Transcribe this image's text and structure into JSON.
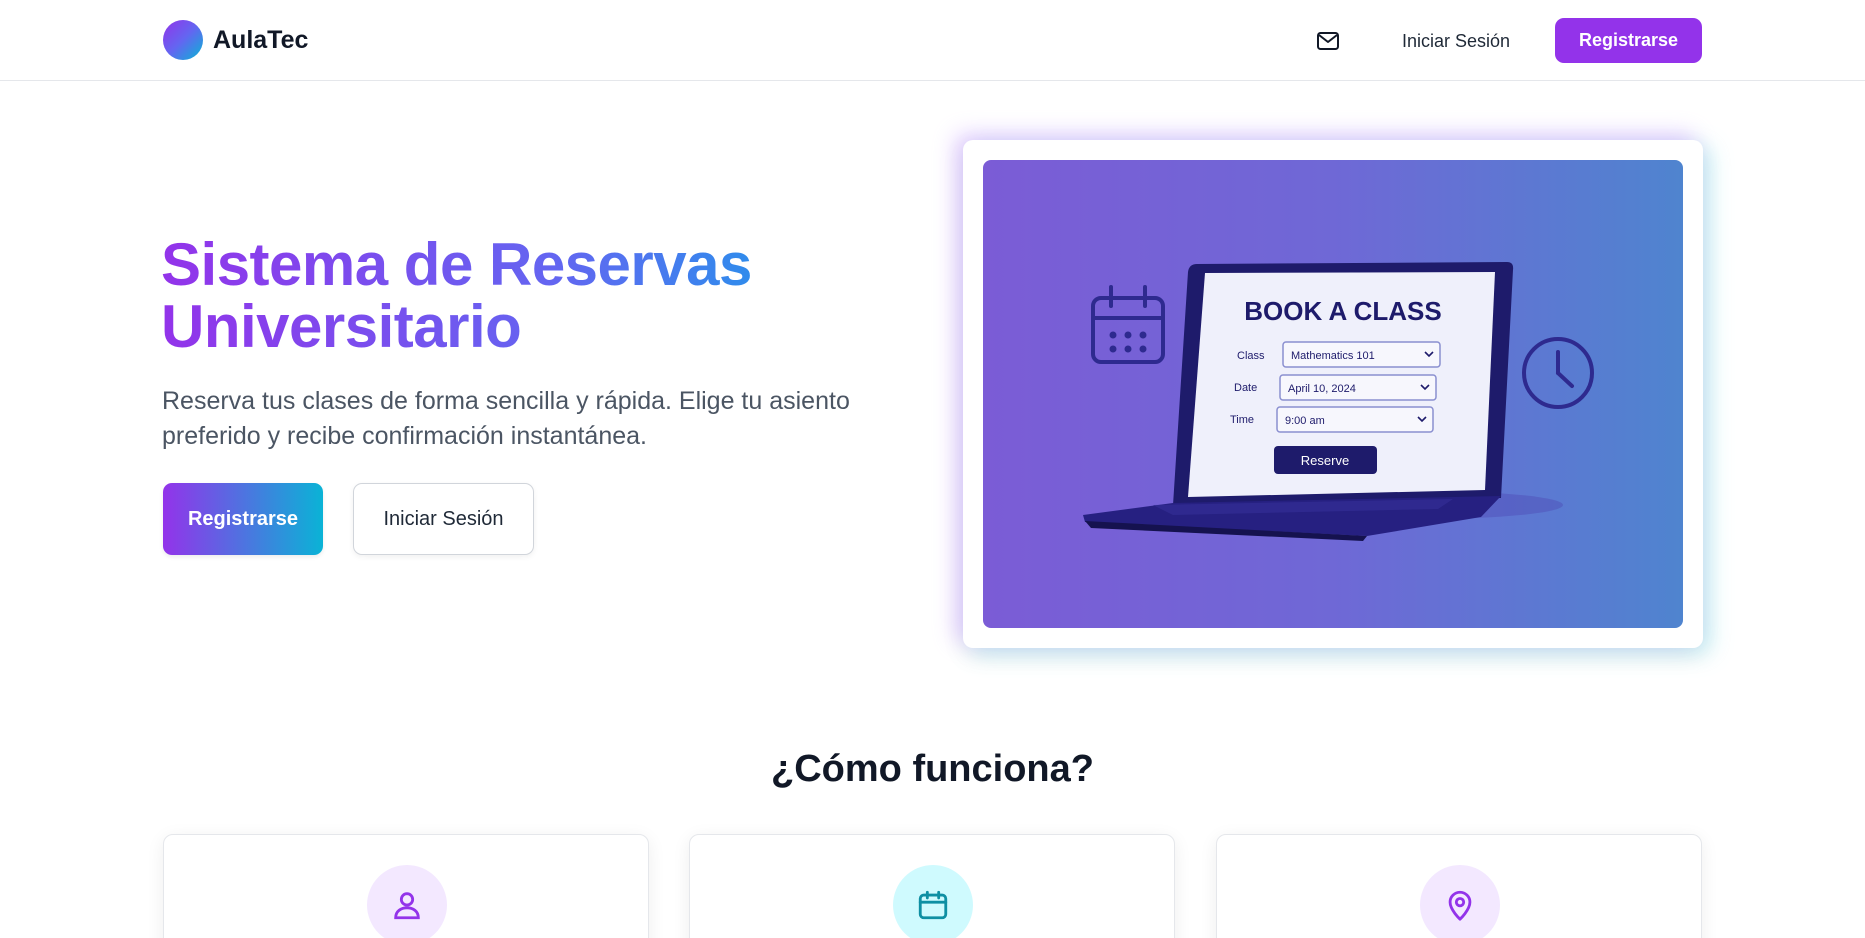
{
  "header": {
    "brand": "AulaTec",
    "mail_icon": "mail-icon",
    "login_label": "Iniciar Sesión",
    "register_label": "Registrarse"
  },
  "hero": {
    "title_line1": "Sistema de Reservas",
    "title_line2": "Universitario",
    "subtitle_line1": "Reserva tus clases de forma sencilla y rápida. Elige tu asiento",
    "subtitle_line2": "preferido y recibe confirmación instantánea.",
    "primary_button": "Registrarse",
    "secondary_button": "Iniciar Sesión"
  },
  "illustration": {
    "heading": "BOOK A CLASS",
    "fields": [
      {
        "label": "Class",
        "value": "Mathematics 101"
      },
      {
        "label": "Date",
        "value": "April 10, 2024"
      },
      {
        "label": "Time",
        "value": "9:00 am"
      }
    ],
    "button": "Reserve",
    "icons": [
      "calendar-icon",
      "clock-icon"
    ]
  },
  "how_it_works": {
    "title": "¿Cómo funciona?",
    "cards": [
      {
        "icon": "user-icon"
      },
      {
        "icon": "calendar-icon"
      },
      {
        "icon": "map-pin-icon"
      }
    ]
  },
  "colors": {
    "primary": "#9333ea",
    "accent": "#06b6d4",
    "text_dark": "#111827",
    "text_muted": "#4b5563",
    "illustration_navy": "#1e1b6b"
  }
}
